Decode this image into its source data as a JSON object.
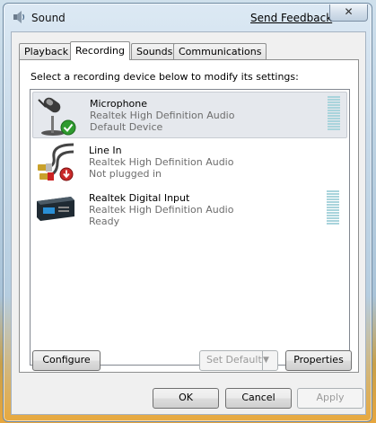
{
  "window": {
    "title": "Sound",
    "feedback_link": "Send Feedback",
    "close_glyph": "✕"
  },
  "tabs": [
    {
      "label": "Playback"
    },
    {
      "label": "Recording"
    },
    {
      "label": "Sounds"
    },
    {
      "label": "Communications"
    }
  ],
  "instruction": "Select a recording device below to modify its settings:",
  "devices": [
    {
      "name": "Microphone",
      "driver": "Realtek High Definition Audio",
      "status": "Default Device",
      "icon": "microphone-icon",
      "badge": "green-check"
    },
    {
      "name": "Line In",
      "driver": "Realtek High Definition Audio",
      "status": "Not plugged in",
      "icon": "line-in-icon",
      "badge": "red-down-arrow"
    },
    {
      "name": "Realtek Digital Input",
      "driver": "Realtek High Definition Audio",
      "status": "Ready",
      "icon": "digital-input-icon",
      "badge": ""
    }
  ],
  "buttons": {
    "configure": "Configure",
    "set_default": "Set Default",
    "properties": "Properties",
    "ok": "OK",
    "cancel": "Cancel",
    "apply": "Apply"
  },
  "colors": {
    "meter": "#a9d4dc",
    "selection": "#e5e8ed"
  }
}
